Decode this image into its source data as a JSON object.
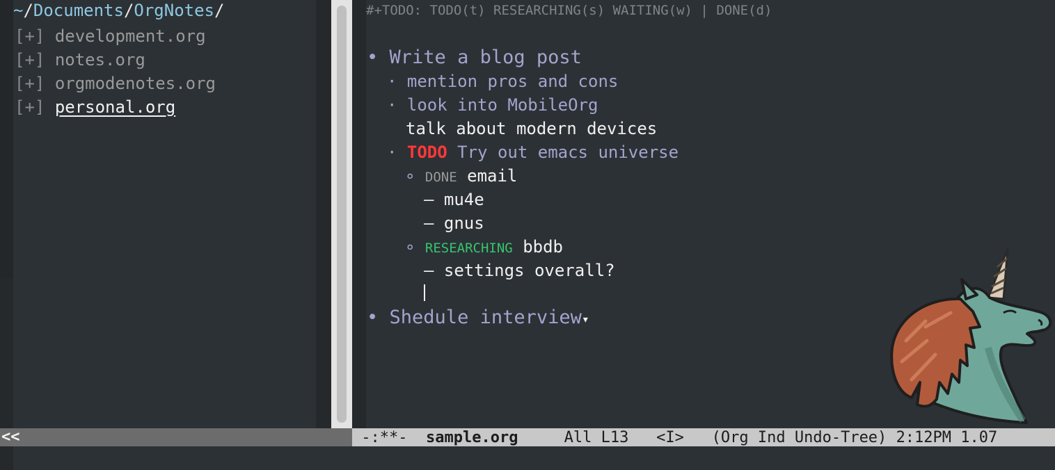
{
  "tree": {
    "root": {
      "home": "~",
      "part1": "Documents",
      "part2": "OrgNotes",
      "sep": "/"
    },
    "items": [
      {
        "expander": "[+]",
        "name": "development.org"
      },
      {
        "expander": "[+]",
        "name": "notes.org"
      },
      {
        "expander": "[+]",
        "name": "orgmodenotes.org"
      },
      {
        "expander": "[+]",
        "name": "personal.org"
      }
    ]
  },
  "buffer": {
    "todo_directive": "#+TODO: TODO(t) RESEARCHING(s) WAITING(w) | DONE(d)",
    "lines": {
      "h1_a": {
        "bullet": "•",
        "text": "Write a blog post"
      },
      "h2_a": {
        "bullet": "·",
        "text": "mention pros and cons"
      },
      "h2_b": {
        "bullet": "·",
        "text": "look into MobileOrg"
      },
      "body_a": "talk about modern devices",
      "h2_c": {
        "bullet": "·",
        "keyword": "TODO",
        "text": "Try out emacs universe"
      },
      "h3_a": {
        "bullet": "∘",
        "keyword": "DONE",
        "text": "email"
      },
      "item_a": "– mu4e",
      "item_b": "– gnus",
      "h3_b": {
        "bullet": "∘",
        "keyword": "RESEARCHING",
        "text": "bbdb"
      },
      "item_c": "– settings overall?",
      "h1_b": {
        "bullet": "•",
        "text": "Shedule interview",
        "fold": "▾"
      }
    }
  },
  "modeline_left": {
    "text": "<<"
  },
  "modeline_right": {
    "status": "-:**-",
    "buffer_name": "sample.org",
    "position": "All L13",
    "evil_state": "<I>",
    "modes": "(Org Ind Undo-Tree)",
    "time": "2:12PM",
    "load": "1.07"
  },
  "colors": {
    "background": "#2c3135",
    "heading": "#a3a4cd",
    "todo": "#ff3838",
    "researching": "#35c56e",
    "done": "#9a9a9a",
    "tree_root": "#8ec7e0"
  },
  "icons": {
    "logo": "emacs-unicorn-icon"
  }
}
